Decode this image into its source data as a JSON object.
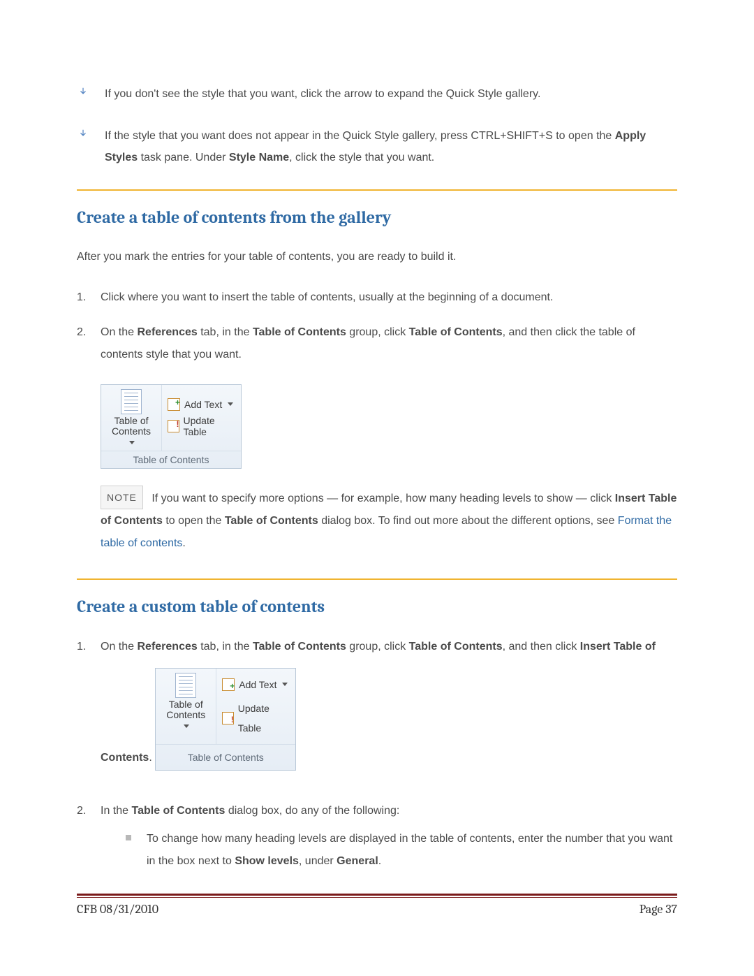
{
  "tips": {
    "t1": "If you don't see the style that you want, click the arrow to expand the Quick Style gallery.",
    "t2_a": "If the style that you want does not appear in the Quick Style gallery, press CTRL+SHIFT+S to open the ",
    "t2_b": "Apply Styles",
    "t2_c": " task pane. Under ",
    "t2_d": "Style Name",
    "t2_e": ", click the style that you want."
  },
  "section1": {
    "heading": "Create a table of contents from the gallery",
    "intro": "After you mark the entries for your table of contents, you are ready to build it.",
    "step1": "Click where you want to insert the table of contents, usually at the beginning of a document.",
    "step2_a": "On the ",
    "step2_b": "References",
    "step2_c": " tab, in the ",
    "step2_d": "Table of Contents",
    "step2_e": " group, click ",
    "step2_f": "Table of Contents",
    "step2_g": ", and then click the table of contents style that you want.",
    "note_label": "NOTE",
    "note_a": "If you want to specify more options — for example, how many heading levels to show — click ",
    "note_b": "Insert Table of Contents",
    "note_c": " to open the ",
    "note_d": "Table of Contents",
    "note_e": " dialog box. To find out more about the different options, see ",
    "note_link": "Format the table of contents",
    "note_f": "."
  },
  "ribbon": {
    "toc_btn": "Table of\nContents",
    "add_text": "Add Text",
    "update": "Update Table",
    "group": "Table of Contents"
  },
  "section2": {
    "heading": "Create a custom table of contents",
    "step1_a": "On the ",
    "step1_b": "References",
    "step1_c": " tab, in the ",
    "step1_d": "Table of Contents",
    "step1_e": " group, click ",
    "step1_f": "Table of Contents",
    "step1_g": ", and then click ",
    "step1_h": "Insert Table of Contents",
    "step1_i": ".",
    "step2_a": "In the ",
    "step2_b": "Table of Contents",
    "step2_c": " dialog box, do any of the following:",
    "sub1_a": "To change how many heading levels are displayed in the table of contents, enter the number that you want in the box next to ",
    "sub1_b": "Show levels",
    "sub1_c": ", under ",
    "sub1_d": "General",
    "sub1_e": "."
  },
  "footer": {
    "left": "CFB 08/31/2010",
    "right": "Page 37"
  }
}
